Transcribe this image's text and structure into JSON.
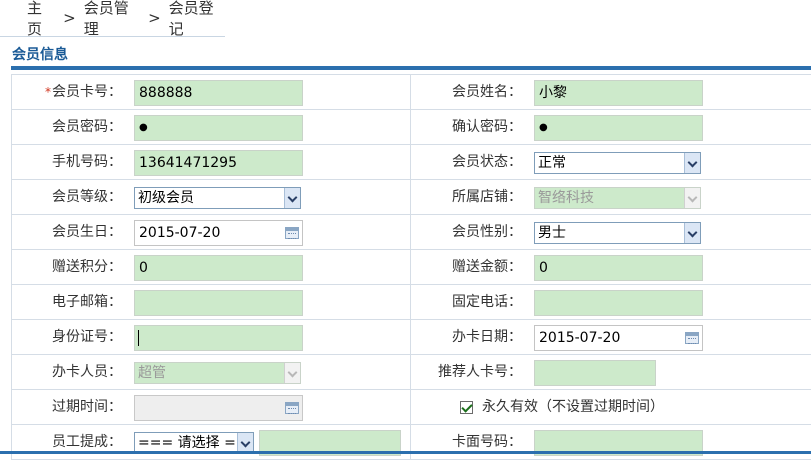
{
  "breadcrumb": [
    "主页",
    "会员管理",
    "会员登记"
  ],
  "breadcrumb_sep": ">",
  "section_title": "会员信息",
  "required_mark": "*",
  "form": {
    "card_no": {
      "label": "会员卡号：",
      "value": "888888"
    },
    "name": {
      "label": "会员姓名：",
      "value": "小黎"
    },
    "password": {
      "label": "会员密码：",
      "value": "●"
    },
    "confirm_password": {
      "label": "确认密码：",
      "value": "●"
    },
    "phone": {
      "label": "手机号码：",
      "value": "13641471295"
    },
    "status": {
      "label": "会员状态：",
      "value": "正常"
    },
    "level": {
      "label": "会员等级：",
      "value": "初级会员"
    },
    "store": {
      "label": "所属店铺：",
      "value": "智络科技"
    },
    "birthday": {
      "label": "会员生日：",
      "value": "2015-07-20"
    },
    "gender": {
      "label": "会员性别：",
      "value": "男士"
    },
    "bonus_points": {
      "label": "赠送积分：",
      "value": "0"
    },
    "bonus_amount": {
      "label": "赠送金额：",
      "value": "0"
    },
    "email": {
      "label": "电子邮箱：",
      "value": ""
    },
    "landline": {
      "label": "固定电话：",
      "value": ""
    },
    "id_no": {
      "label": "身份证号：",
      "value": ""
    },
    "card_date": {
      "label": "办卡日期：",
      "value": "2015-07-20"
    },
    "card_staff": {
      "label": "办卡人员：",
      "value": "超管"
    },
    "referrer_card": {
      "label": "推荐人卡号：",
      "value": ""
    },
    "expire_time": {
      "label": "过期时间：",
      "value": ""
    },
    "permanent": {
      "label": "永久有效（不设置过期时间）",
      "checked": true
    },
    "staff_commission": {
      "label": "员工提成：",
      "value": "=== 请选择 ===",
      "extra": ""
    },
    "card_face_no": {
      "label": "卡面号码：",
      "value": ""
    }
  },
  "colors": {
    "accent": "#2b6fae",
    "title": "#1a5a96",
    "field_bg": "#cdeacb",
    "required": "#d0341e"
  }
}
